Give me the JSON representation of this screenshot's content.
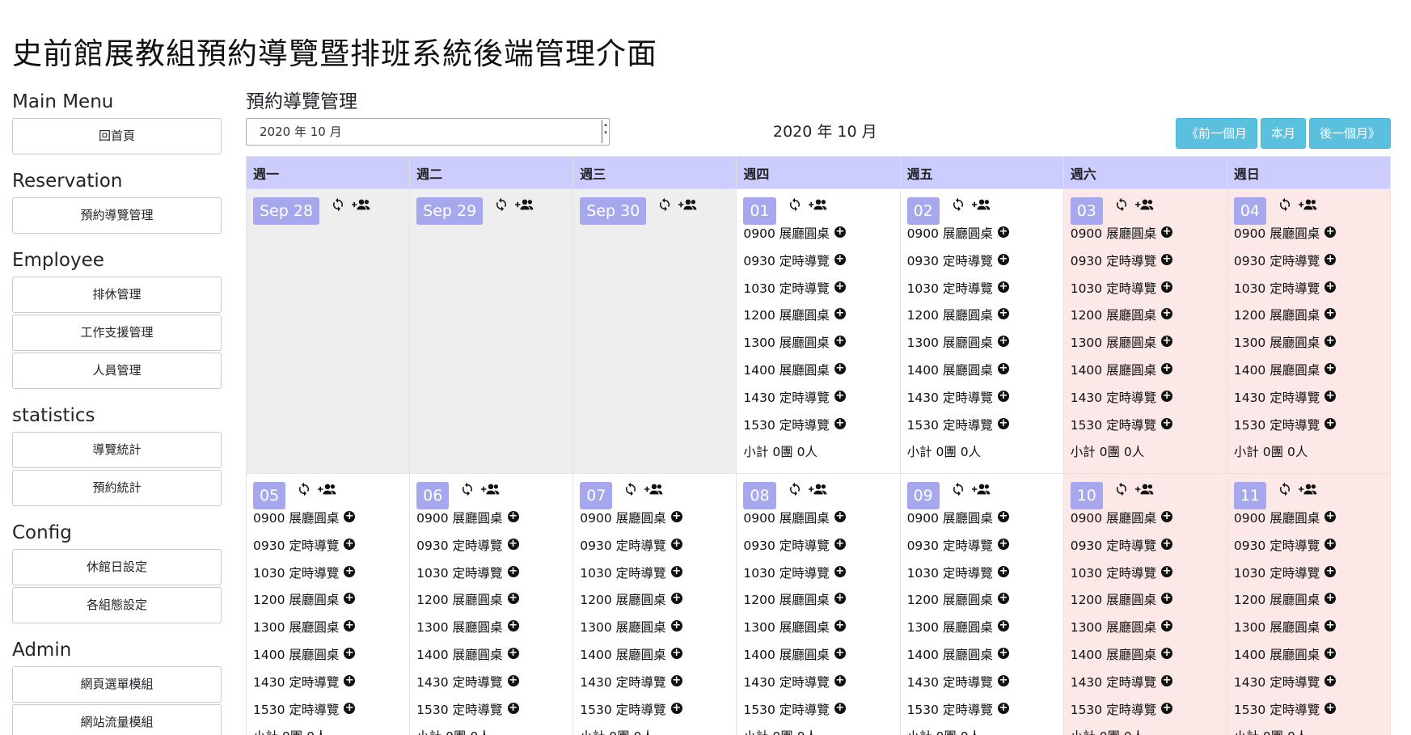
{
  "page_title": "史前館展教組預約導覽暨排班系統後端管理介面",
  "sidebar": [
    {
      "heading": "Main Menu",
      "items": [
        "回首頁"
      ]
    },
    {
      "heading": "Reservation",
      "items": [
        "預約導覽管理"
      ]
    },
    {
      "heading": "Employee",
      "items": [
        "排休管理",
        "工作支援管理",
        "人員管理"
      ]
    },
    {
      "heading": "statistics",
      "items": [
        "導覽統計",
        "預約統計"
      ]
    },
    {
      "heading": "Config",
      "items": [
        "休館日設定",
        "各組態設定"
      ]
    },
    {
      "heading": "Admin",
      "items": [
        "網頁選單模組",
        "網站流量模組"
      ]
    }
  ],
  "main": {
    "heading": "預約導覽管理",
    "month_select_value": "2020 年 10 月",
    "month_label": "2020 年 10 月",
    "nav": {
      "prev": "《前一個月",
      "current": "本月",
      "next": "後一個月》"
    }
  },
  "icons": {
    "refresh": "refresh-icon",
    "add_group": "add-group-icon",
    "add_slot": "plus-circle-icon"
  },
  "colors": {
    "header_bg": "#ccccff",
    "badge_bg": "#a7a7ee",
    "weekend_bg": "#fde8e8",
    "outside_bg": "#eeeeee",
    "nav_btn": "#5bc0de"
  },
  "calendar": {
    "weekdays": [
      "週一",
      "週二",
      "週三",
      "週四",
      "週五",
      "週六",
      "週日"
    ],
    "slots": [
      "0900 展廳圓桌",
      "0930 定時導覽",
      "1030 定時導覽",
      "1200 展廳圓桌",
      "1300 展廳圓桌",
      "1400 展廳圓桌",
      "1430 定時導覽",
      "1530 定時導覽"
    ],
    "subtotal": "小計 0團 0人",
    "weeks": [
      [
        {
          "label": "Sep 28",
          "type": "outside"
        },
        {
          "label": "Sep 29",
          "type": "outside"
        },
        {
          "label": "Sep 30",
          "type": "outside"
        },
        {
          "label": "01",
          "type": "normal"
        },
        {
          "label": "02",
          "type": "normal"
        },
        {
          "label": "03",
          "type": "weekend"
        },
        {
          "label": "04",
          "type": "weekend"
        }
      ],
      [
        {
          "label": "05",
          "type": "normal"
        },
        {
          "label": "06",
          "type": "normal"
        },
        {
          "label": "07",
          "type": "normal"
        },
        {
          "label": "08",
          "type": "normal"
        },
        {
          "label": "09",
          "type": "normal"
        },
        {
          "label": "10",
          "type": "weekend"
        },
        {
          "label": "11",
          "type": "weekend"
        }
      ]
    ]
  }
}
